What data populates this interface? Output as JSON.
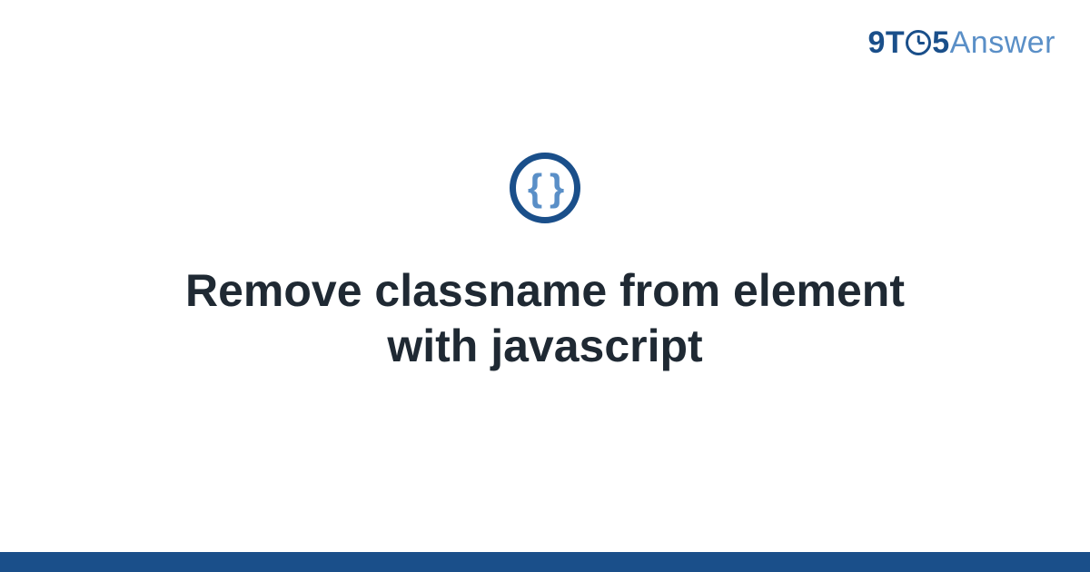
{
  "logo": {
    "part1": "9T",
    "part2": "5",
    "part3": "Answer"
  },
  "topic_icon": {
    "glyph": "{ }",
    "name": "code-braces-icon"
  },
  "title": "Remove classname from element with javascript",
  "colors": {
    "brand_dark": "#1a4f8a",
    "brand_light": "#5a8fc7",
    "text": "#1f2933"
  }
}
